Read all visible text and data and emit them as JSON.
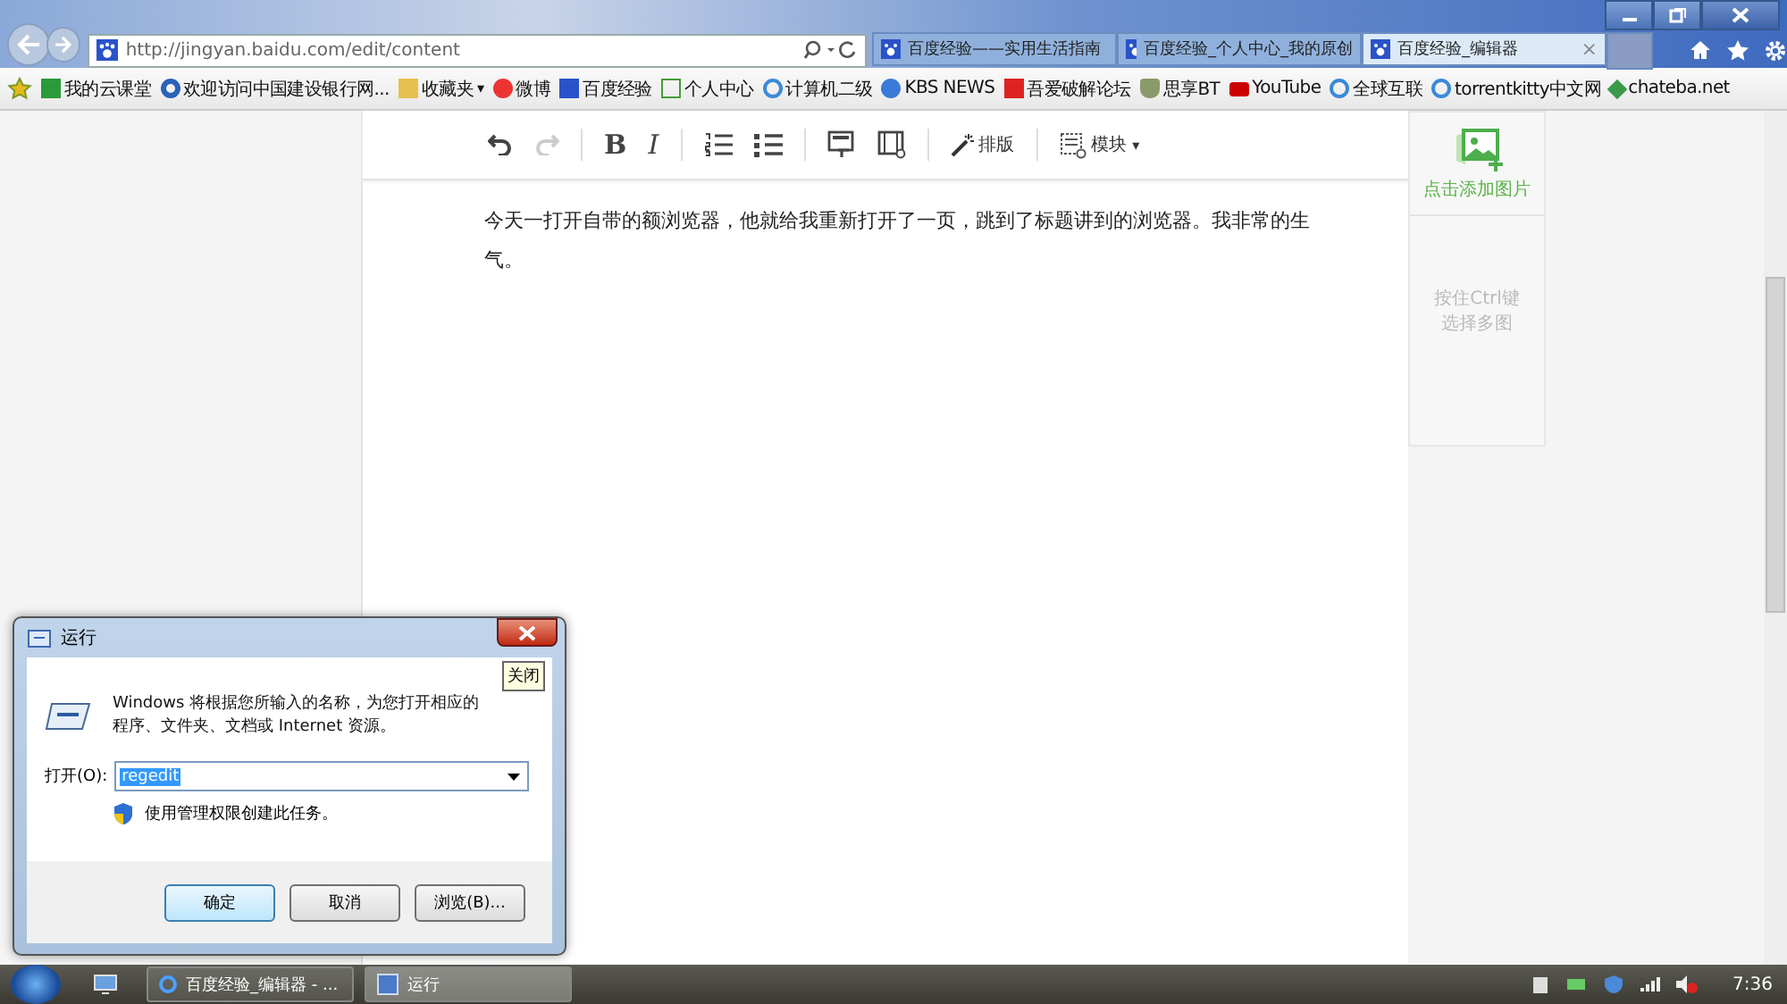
{
  "browser": {
    "address": "http://jingyan.baidu.com/edit/content",
    "tabs": [
      {
        "title": "百度经验——实用生活指南",
        "selected": false
      },
      {
        "title": "百度经验_个人中心_我的原创",
        "selected": false
      },
      {
        "title": "百度经验_编辑器",
        "selected": true,
        "close": "×"
      }
    ]
  },
  "bookmarks": [
    {
      "label": "我的云课堂"
    },
    {
      "label": "欢迎访问中国建设银行网..."
    },
    {
      "label": "收藏夹",
      "menu": "▾"
    },
    {
      "label": "微博"
    },
    {
      "label": "百度经验"
    },
    {
      "label": "个人中心"
    },
    {
      "label": "计算机二级"
    },
    {
      "label": "KBS NEWS"
    },
    {
      "label": "吾爱破解论坛"
    },
    {
      "label": "思享BT"
    },
    {
      "label": "YouTube"
    },
    {
      "label": "全球互联"
    },
    {
      "label": "torrentkitty中文网"
    },
    {
      "label": "chateba.net"
    }
  ],
  "toolbar": [
    {
      "kind": "undo",
      "disabled": false
    },
    {
      "kind": "redo",
      "disabled": true
    },
    {
      "kind": "sep"
    },
    {
      "kind": "bold",
      "label": "B"
    },
    {
      "kind": "italic",
      "label": "I"
    },
    {
      "kind": "sep"
    },
    {
      "kind": "ol"
    },
    {
      "kind": "ul"
    },
    {
      "kind": "sep"
    },
    {
      "kind": "image"
    },
    {
      "kind": "video"
    },
    {
      "kind": "sep"
    },
    {
      "kind": "wand",
      "label": "排版"
    },
    {
      "kind": "sep"
    },
    {
      "kind": "module",
      "label": "模块",
      "menu": "▾"
    }
  ],
  "content": "今天一打开自带的额浏览器，他就给我重新打开了一页，跳到了标题讲到的浏览器。我非常的生气。",
  "sidebar": {
    "add_image": "点击添加图片",
    "hint_lines": [
      "按住Ctrl键",
      "选择多图"
    ]
  },
  "run_dialog": {
    "title": "运行",
    "close_tooltip": "关闭",
    "description": "Windows 将根据您所输入的名称，为您打开相应的程序、文件夹、文档或 Internet 资源。",
    "open_label": "打开(O):",
    "value": "regedit",
    "admin_note": "使用管理权限创建此任务。",
    "buttons": [
      {
        "label": "确定",
        "default": true
      },
      {
        "label": "取消",
        "default": false
      },
      {
        "label": "浏览(B)...",
        "default": false
      }
    ]
  },
  "taskbar": {
    "items": [
      {
        "label": "百度经验_编辑器 - ...",
        "kind": "browser",
        "selected": false
      },
      {
        "label": "运行",
        "kind": "run",
        "selected": true
      }
    ],
    "clock": "7:36"
  }
}
